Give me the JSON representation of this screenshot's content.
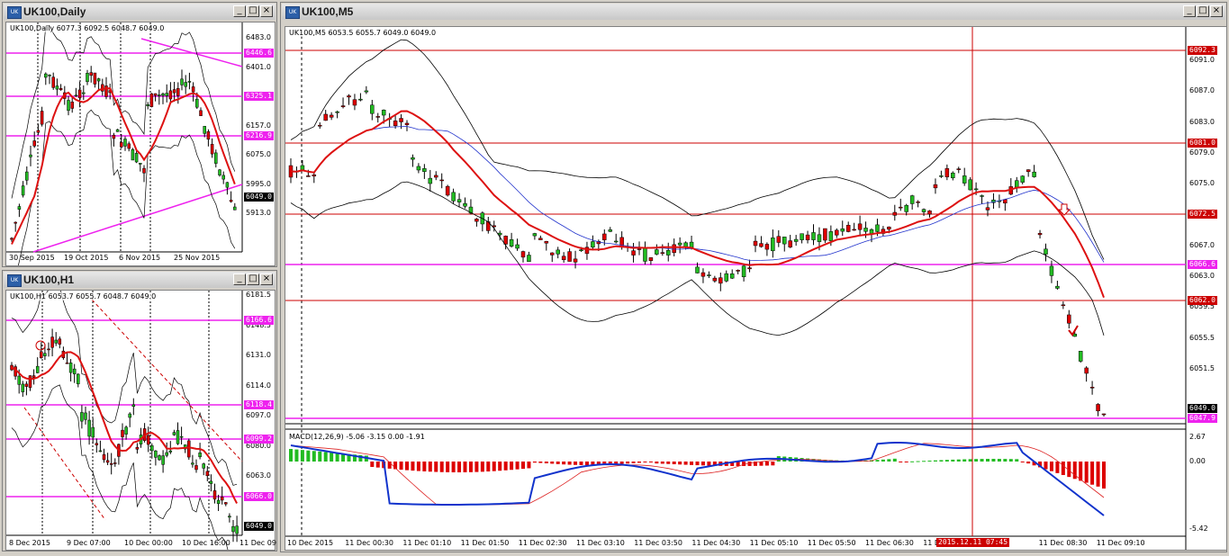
{
  "windows": {
    "daily": {
      "title": "UK100,Daily",
      "header": "UK100,Daily  6077.3 6092.5 6048.7 6049.0",
      "yticks": [
        "6483.0",
        "6401.0",
        "6239.0",
        "6157.0",
        "6075.0",
        "5995.0",
        "5913.0"
      ],
      "xticks": [
        "30 Sep 2015",
        "19 Oct 2015",
        "6 Nov 2015",
        "25 Nov 2015"
      ],
      "tags": [
        "6446.6",
        "6325.1",
        "6216.9",
        "6049.0"
      ]
    },
    "h1": {
      "title": "UK100,H1",
      "header": "UK100,H1  6053.7 6055.7 6048.7 6049.0",
      "yticks": [
        "6181.5",
        "6148.5",
        "6131.0",
        "6114.0",
        "6097.0",
        "6080.0",
        "6063.0"
      ],
      "xticks": [
        "8 Dec 2015",
        "9 Dec 07:00",
        "10 Dec 00:00",
        "10 Dec 16:00",
        "11 Dec 09"
      ],
      "tags": [
        "6166.6",
        "6118.4",
        "6099.2",
        "6066.0",
        "6049.0"
      ]
    },
    "m5": {
      "title": "UK100,M5",
      "header": "UK100,M5  6053.5 6055.7 6049.0 6049.0",
      "yticks": [
        "6091.0",
        "6087.0",
        "6083.0",
        "6079.0",
        "6075.0",
        "6071.0",
        "6067.0",
        "6063.0",
        "6059.5",
        "6055.5",
        "6051.5"
      ],
      "tags": [
        "6092.3",
        "6081.0",
        "6072.5",
        "6066.6",
        "6062.0",
        "6049.0",
        "6047.9"
      ],
      "macd_label": "MACD(12,26,9) -5.06 -3.15 0.00 -1.91",
      "macd_ticks": [
        "2.67",
        "0.00",
        "-5.42"
      ],
      "xticks": [
        "10 Dec 2015",
        "11 Dec 00:30",
        "11 Dec 01:10",
        "11 Dec 01:50",
        "11 Dec 02:30",
        "11 Dec 03:10",
        "11 Dec 03:50",
        "11 Dec 04:30",
        "11 Dec 05:10",
        "11 Dec 05:50",
        "11 Dec 06:30",
        "11 D",
        "07:50",
        "11 Dec 08:30",
        "11 Dec 09:10"
      ],
      "cursor_time": "2015.12.11 07:45"
    }
  },
  "colors": {
    "bull": "#22bb22",
    "bear": "#dd0000",
    "ma": "#dd1111",
    "ma2": "#2233cc",
    "hline": "#cc0000",
    "magenta": "#ee22ee",
    "band": "#000000",
    "signal": "#dd2222",
    "macdline": "#1133cc"
  }
}
